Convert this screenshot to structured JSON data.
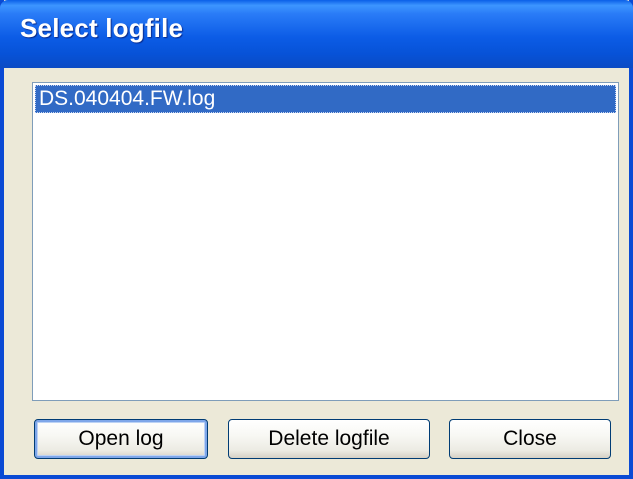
{
  "window": {
    "title": "Select logfile"
  },
  "logfile_list": {
    "items": [
      {
        "label": "DS.040404.FW.log",
        "selected": true
      }
    ]
  },
  "buttons": {
    "open_label": "Open log",
    "delete_label": "Delete logfile",
    "close_label": "Close"
  },
  "colors": {
    "titlebar": "#0b5ce6",
    "selection": "#316ac5",
    "dialog_background": "#ece9d8",
    "button_border": "#003c74"
  }
}
